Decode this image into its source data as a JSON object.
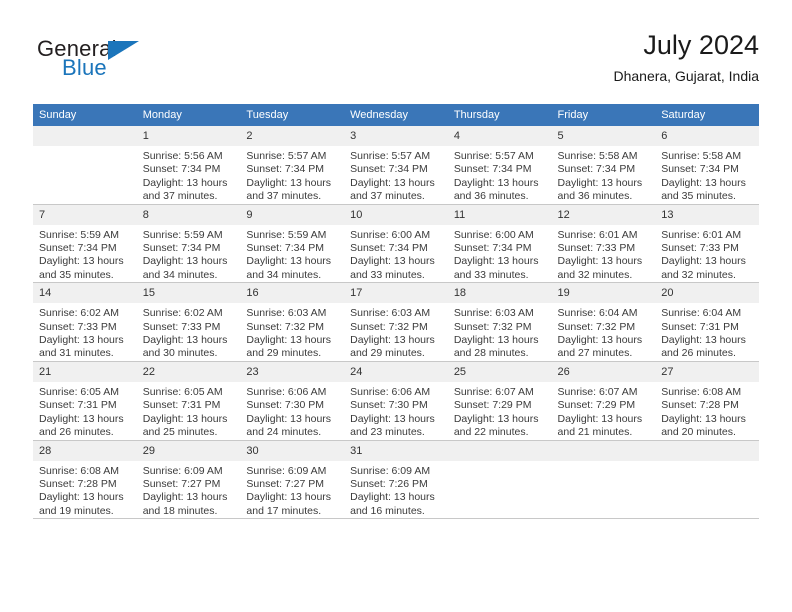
{
  "brand": {
    "name_part1": "General",
    "name_part2": "Blue",
    "triangle_icon": "triangle-logo-icon",
    "accent_color": "#1b75bb"
  },
  "header": {
    "title": "July 2024",
    "location": "Dhanera, Gujarat, India"
  },
  "calendar": {
    "header_bg_color": "#3a76b8",
    "weekday_headers": [
      "Sunday",
      "Monday",
      "Tuesday",
      "Wednesday",
      "Thursday",
      "Friday",
      "Saturday"
    ],
    "weeks": [
      [
        {
          "day": "",
          "sunrise": "",
          "sunset": "",
          "daylight_line1": "",
          "daylight_line2": "",
          "empty": true
        },
        {
          "day": "1",
          "sunrise": "Sunrise: 5:56 AM",
          "sunset": "Sunset: 7:34 PM",
          "daylight_line1": "Daylight: 13 hours",
          "daylight_line2": "and 37 minutes."
        },
        {
          "day": "2",
          "sunrise": "Sunrise: 5:57 AM",
          "sunset": "Sunset: 7:34 PM",
          "daylight_line1": "Daylight: 13 hours",
          "daylight_line2": "and 37 minutes."
        },
        {
          "day": "3",
          "sunrise": "Sunrise: 5:57 AM",
          "sunset": "Sunset: 7:34 PM",
          "daylight_line1": "Daylight: 13 hours",
          "daylight_line2": "and 37 minutes."
        },
        {
          "day": "4",
          "sunrise": "Sunrise: 5:57 AM",
          "sunset": "Sunset: 7:34 PM",
          "daylight_line1": "Daylight: 13 hours",
          "daylight_line2": "and 36 minutes."
        },
        {
          "day": "5",
          "sunrise": "Sunrise: 5:58 AM",
          "sunset": "Sunset: 7:34 PM",
          "daylight_line1": "Daylight: 13 hours",
          "daylight_line2": "and 36 minutes."
        },
        {
          "day": "6",
          "sunrise": "Sunrise: 5:58 AM",
          "sunset": "Sunset: 7:34 PM",
          "daylight_line1": "Daylight: 13 hours",
          "daylight_line2": "and 35 minutes."
        }
      ],
      [
        {
          "day": "7",
          "sunrise": "Sunrise: 5:59 AM",
          "sunset": "Sunset: 7:34 PM",
          "daylight_line1": "Daylight: 13 hours",
          "daylight_line2": "and 35 minutes."
        },
        {
          "day": "8",
          "sunrise": "Sunrise: 5:59 AM",
          "sunset": "Sunset: 7:34 PM",
          "daylight_line1": "Daylight: 13 hours",
          "daylight_line2": "and 34 minutes."
        },
        {
          "day": "9",
          "sunrise": "Sunrise: 5:59 AM",
          "sunset": "Sunset: 7:34 PM",
          "daylight_line1": "Daylight: 13 hours",
          "daylight_line2": "and 34 minutes."
        },
        {
          "day": "10",
          "sunrise": "Sunrise: 6:00 AM",
          "sunset": "Sunset: 7:34 PM",
          "daylight_line1": "Daylight: 13 hours",
          "daylight_line2": "and 33 minutes."
        },
        {
          "day": "11",
          "sunrise": "Sunrise: 6:00 AM",
          "sunset": "Sunset: 7:34 PM",
          "daylight_line1": "Daylight: 13 hours",
          "daylight_line2": "and 33 minutes."
        },
        {
          "day": "12",
          "sunrise": "Sunrise: 6:01 AM",
          "sunset": "Sunset: 7:33 PM",
          "daylight_line1": "Daylight: 13 hours",
          "daylight_line2": "and 32 minutes."
        },
        {
          "day": "13",
          "sunrise": "Sunrise: 6:01 AM",
          "sunset": "Sunset: 7:33 PM",
          "daylight_line1": "Daylight: 13 hours",
          "daylight_line2": "and 32 minutes."
        }
      ],
      [
        {
          "day": "14",
          "sunrise": "Sunrise: 6:02 AM",
          "sunset": "Sunset: 7:33 PM",
          "daylight_line1": "Daylight: 13 hours",
          "daylight_line2": "and 31 minutes."
        },
        {
          "day": "15",
          "sunrise": "Sunrise: 6:02 AM",
          "sunset": "Sunset: 7:33 PM",
          "daylight_line1": "Daylight: 13 hours",
          "daylight_line2": "and 30 minutes."
        },
        {
          "day": "16",
          "sunrise": "Sunrise: 6:03 AM",
          "sunset": "Sunset: 7:32 PM",
          "daylight_line1": "Daylight: 13 hours",
          "daylight_line2": "and 29 minutes."
        },
        {
          "day": "17",
          "sunrise": "Sunrise: 6:03 AM",
          "sunset": "Sunset: 7:32 PM",
          "daylight_line1": "Daylight: 13 hours",
          "daylight_line2": "and 29 minutes."
        },
        {
          "day": "18",
          "sunrise": "Sunrise: 6:03 AM",
          "sunset": "Sunset: 7:32 PM",
          "daylight_line1": "Daylight: 13 hours",
          "daylight_line2": "and 28 minutes."
        },
        {
          "day": "19",
          "sunrise": "Sunrise: 6:04 AM",
          "sunset": "Sunset: 7:32 PM",
          "daylight_line1": "Daylight: 13 hours",
          "daylight_line2": "and 27 minutes."
        },
        {
          "day": "20",
          "sunrise": "Sunrise: 6:04 AM",
          "sunset": "Sunset: 7:31 PM",
          "daylight_line1": "Daylight: 13 hours",
          "daylight_line2": "and 26 minutes."
        }
      ],
      [
        {
          "day": "21",
          "sunrise": "Sunrise: 6:05 AM",
          "sunset": "Sunset: 7:31 PM",
          "daylight_line1": "Daylight: 13 hours",
          "daylight_line2": "and 26 minutes."
        },
        {
          "day": "22",
          "sunrise": "Sunrise: 6:05 AM",
          "sunset": "Sunset: 7:31 PM",
          "daylight_line1": "Daylight: 13 hours",
          "daylight_line2": "and 25 minutes."
        },
        {
          "day": "23",
          "sunrise": "Sunrise: 6:06 AM",
          "sunset": "Sunset: 7:30 PM",
          "daylight_line1": "Daylight: 13 hours",
          "daylight_line2": "and 24 minutes."
        },
        {
          "day": "24",
          "sunrise": "Sunrise: 6:06 AM",
          "sunset": "Sunset: 7:30 PM",
          "daylight_line1": "Daylight: 13 hours",
          "daylight_line2": "and 23 minutes."
        },
        {
          "day": "25",
          "sunrise": "Sunrise: 6:07 AM",
          "sunset": "Sunset: 7:29 PM",
          "daylight_line1": "Daylight: 13 hours",
          "daylight_line2": "and 22 minutes."
        },
        {
          "day": "26",
          "sunrise": "Sunrise: 6:07 AM",
          "sunset": "Sunset: 7:29 PM",
          "daylight_line1": "Daylight: 13 hours",
          "daylight_line2": "and 21 minutes."
        },
        {
          "day": "27",
          "sunrise": "Sunrise: 6:08 AM",
          "sunset": "Sunset: 7:28 PM",
          "daylight_line1": "Daylight: 13 hours",
          "daylight_line2": "and 20 minutes."
        }
      ],
      [
        {
          "day": "28",
          "sunrise": "Sunrise: 6:08 AM",
          "sunset": "Sunset: 7:28 PM",
          "daylight_line1": "Daylight: 13 hours",
          "daylight_line2": "and 19 minutes."
        },
        {
          "day": "29",
          "sunrise": "Sunrise: 6:09 AM",
          "sunset": "Sunset: 7:27 PM",
          "daylight_line1": "Daylight: 13 hours",
          "daylight_line2": "and 18 minutes."
        },
        {
          "day": "30",
          "sunrise": "Sunrise: 6:09 AM",
          "sunset": "Sunset: 7:27 PM",
          "daylight_line1": "Daylight: 13 hours",
          "daylight_line2": "and 17 minutes."
        },
        {
          "day": "31",
          "sunrise": "Sunrise: 6:09 AM",
          "sunset": "Sunset: 7:26 PM",
          "daylight_line1": "Daylight: 13 hours",
          "daylight_line2": "and 16 minutes."
        },
        {
          "day": "",
          "sunrise": "",
          "sunset": "",
          "daylight_line1": "",
          "daylight_line2": "",
          "empty": true
        },
        {
          "day": "",
          "sunrise": "",
          "sunset": "",
          "daylight_line1": "",
          "daylight_line2": "",
          "empty": true
        },
        {
          "day": "",
          "sunrise": "",
          "sunset": "",
          "daylight_line1": "",
          "daylight_line2": "",
          "empty": true
        }
      ]
    ]
  }
}
